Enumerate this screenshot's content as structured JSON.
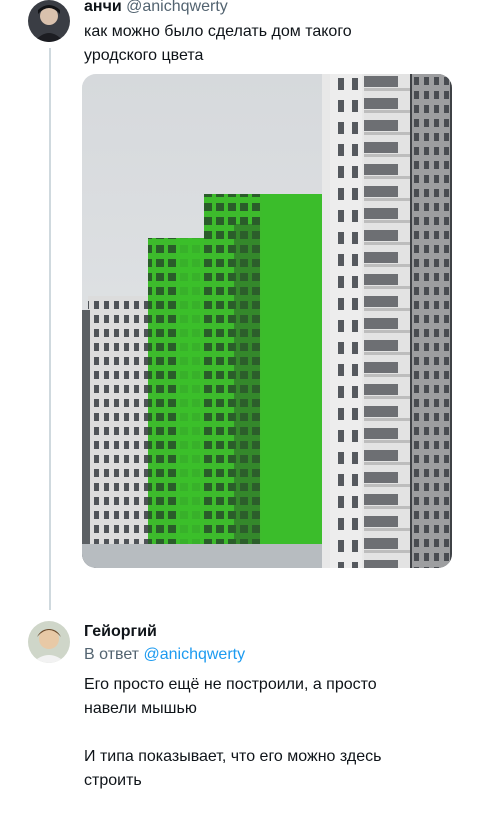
{
  "tweet": {
    "author_name": "анчи",
    "author_handle": "@anichqwerty",
    "text_line1": "как можно было сделать дом такого",
    "text_line2": "уродского цвета"
  },
  "reply": {
    "author_name": "Гейоргий",
    "reply_prefix": "В ответ",
    "reply_mention": "@anichqwerty",
    "para1_line1": "Его просто ещё не построили, а просто",
    "para1_line2": "навели мышью",
    "para2_line1": "И типа показывает, что его можно здесь",
    "para2_line2": "строить"
  },
  "colors": {
    "link": "#1d9bf0",
    "thread_line": "#cfd9de",
    "building_green": "#3fc12e",
    "muted_text": "#536471"
  }
}
